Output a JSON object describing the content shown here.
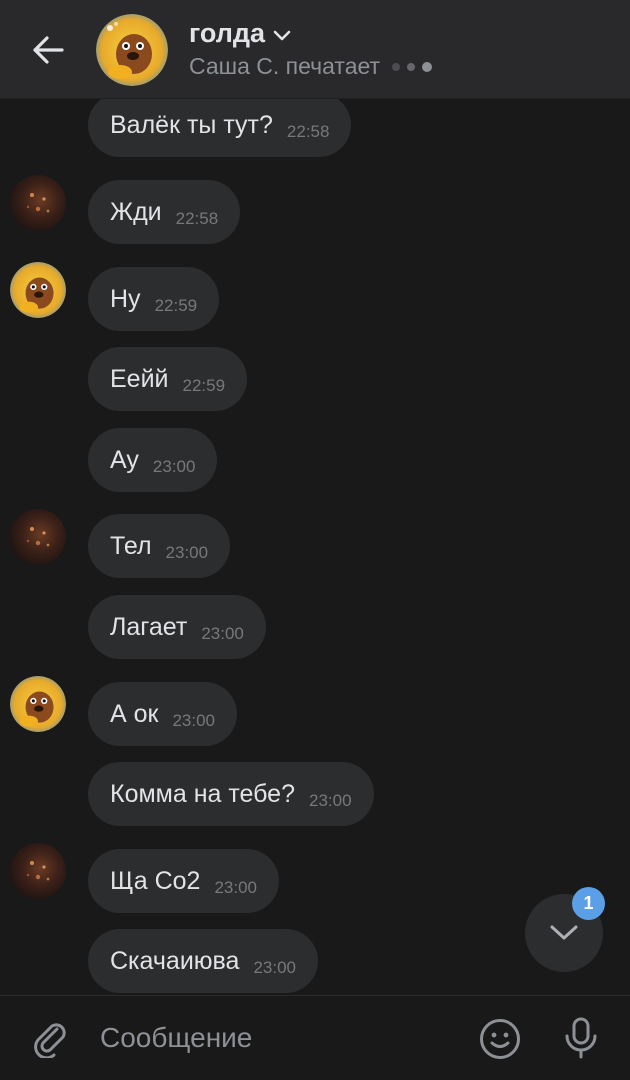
{
  "header": {
    "title": "голда",
    "status": "Саша С. печатает",
    "back_icon": "arrow-left-icon",
    "title_icon": "chevron-down-icon"
  },
  "messages": [
    {
      "text": "Валёк ты тут?",
      "time": "22:58",
      "avatar": null
    },
    {
      "text": "Жди",
      "time": "22:58",
      "avatar": "dark"
    },
    {
      "text": "Ну",
      "time": "22:59",
      "avatar": "bear"
    },
    {
      "text": "Еейй",
      "time": "22:59",
      "avatar": null
    },
    {
      "text": "Ау",
      "time": "23:00",
      "avatar": null
    },
    {
      "text": "Тел",
      "time": "23:00",
      "avatar": "dark"
    },
    {
      "text": "Лагает",
      "time": "23:00",
      "avatar": null
    },
    {
      "text": "А ок",
      "time": "23:00",
      "avatar": "bear"
    },
    {
      "text": "Комма на тебе?",
      "time": "23:00",
      "avatar": null
    },
    {
      "text": "Ща Со2",
      "time": "23:00",
      "avatar": "dark"
    },
    {
      "text": "Скачаиюва",
      "time": "23:00",
      "avatar": null
    }
  ],
  "scroll_down": {
    "unread_count": "1",
    "icon": "chevron-down-icon"
  },
  "composer": {
    "placeholder": "Сообщение",
    "attach_icon": "paperclip-icon",
    "emoji_icon": "smiley-icon",
    "mic_icon": "microphone-icon"
  },
  "colors": {
    "background": "#19191a",
    "header": "#29292b",
    "bubble": "#2c2d2e",
    "text": "#e1e3e6",
    "secondary_text": "#8d9196",
    "badge": "#5b9fe6"
  }
}
